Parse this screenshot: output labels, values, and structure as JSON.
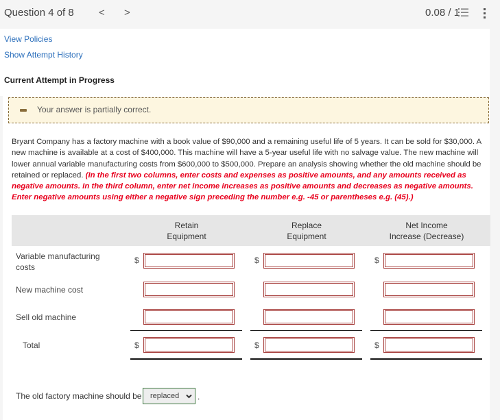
{
  "header": {
    "question_label": "Question 4 of 8",
    "prev_icon": "chevron-left-icon",
    "next_icon": "chevron-right-icon",
    "prev_glyph": "<",
    "next_glyph": ">",
    "score": "0.08 / 1",
    "list_icon": "numbered-list-icon",
    "more_icon": "more-vertical-icon"
  },
  "links": {
    "view_policies": "View Policies",
    "show_attempt_history": "Show Attempt History"
  },
  "attempt_title": "Current Attempt in Progress",
  "feedback": {
    "icon": "partial-dash-icon",
    "text": "Your answer is partially correct.",
    "background": "#fdf6e0",
    "border_color": "#8a6d3b"
  },
  "problem": {
    "text": "Bryant Company has a factory machine with a book value of $90,000 and a remaining useful life of 5 years. It can be sold for $30,000. A new machine is available at a cost of $400,000. This machine will have a 5-year useful life with no salvage value. The new machine will lower annual variable manufacturing costs from $600,000 to $500,000. Prepare an analysis showing whether the old machine should be retained or replaced. ",
    "instructions": "(In the first two columns, enter costs and expenses as positive amounts, and any amounts received as negative amounts.  In the third column, enter net income increases as positive amounts and decreases as negative amounts. Enter negative amounts using either a negative sign preceding the number e.g. -45 or parentheses e.g. (45).)",
    "instructions_color": "#e8001d"
  },
  "table": {
    "columns": [
      {
        "line1": "Retain",
        "line2": "Equipment"
      },
      {
        "line1": "Replace",
        "line2": "Equipment"
      },
      {
        "line1": "Net Income",
        "line2": "Increase (Decrease)"
      }
    ],
    "currency_symbol": "$",
    "rows": [
      {
        "label": "Variable manufacturing costs",
        "values": [
          "",
          "",
          ""
        ],
        "show_currency": true
      },
      {
        "label": "New machine cost",
        "values": [
          "",
          "",
          ""
        ],
        "show_currency": false
      },
      {
        "label": "Sell old machine",
        "values": [
          "",
          "",
          ""
        ],
        "show_currency": false
      },
      {
        "label": "Total",
        "values": [
          "",
          "",
          ""
        ],
        "show_currency": true
      }
    ],
    "input_border_color": "#a94442"
  },
  "conclusion": {
    "prefix": "The old factory machine should be",
    "selected": "replaced",
    "suffix": "."
  }
}
